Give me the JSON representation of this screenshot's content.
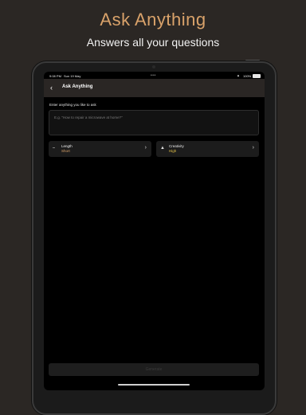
{
  "hero": {
    "title": "Ask Anything",
    "subtitle": "Answers all your questions"
  },
  "status_bar": {
    "time": "9:08 PM",
    "date": "Sun 19 May",
    "dots": "•••",
    "battery_pct": "100%"
  },
  "nav": {
    "back_icon": "‹",
    "title": "Ask Anything"
  },
  "form": {
    "prompt_label": "Enter anything you like to ask",
    "prompt_placeholder": "E.g. \"How to repair a microwave at home?\""
  },
  "options": {
    "length": {
      "icon": "ruler-icon",
      "label": "Length",
      "value": "Short"
    },
    "creativity": {
      "icon": "hat-icon",
      "label": "Creativity",
      "value": "High"
    }
  },
  "actions": {
    "generate_label": "Generate"
  },
  "colors": {
    "background": "#2b2724",
    "accent": "#d9a26a",
    "creativity_value": "#e8c548"
  }
}
